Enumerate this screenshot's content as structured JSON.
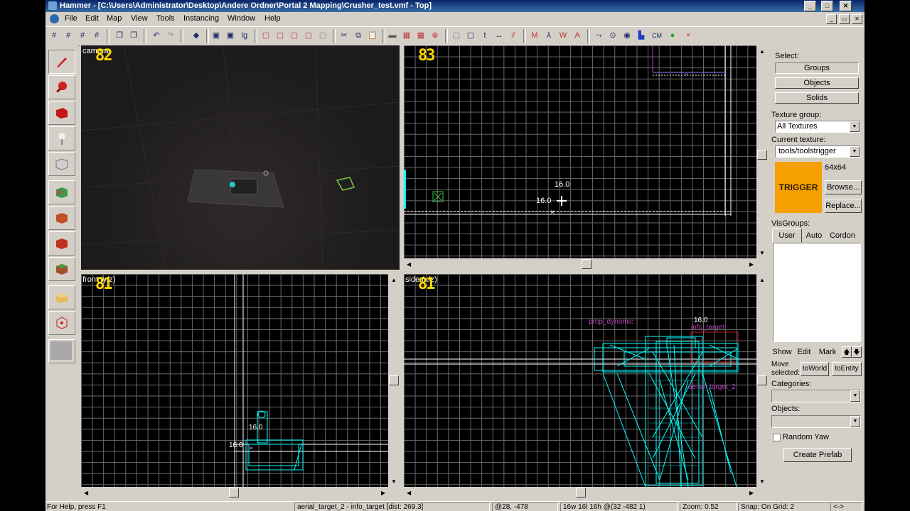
{
  "window": {
    "title": "Hammer - [C:\\Users\\Administrator\\Desktop\\Andere Ordner\\Portal 2 Mapping\\Crusher_test.vmf - Top]"
  },
  "title_controls": {
    "minimize": "_",
    "maximize": "□",
    "close": "✕"
  },
  "mdi_controls": {
    "minimize": "_",
    "restore": "▭",
    "close": "✕"
  },
  "menu": [
    "File",
    "Edit",
    "Map",
    "View",
    "Tools",
    "Instancing",
    "Window",
    "Help"
  ],
  "toolbar": {
    "cordon_label": "CM"
  },
  "viewports": {
    "camera": {
      "label": "camera",
      "number": "82"
    },
    "top": {
      "label": "",
      "number": "83",
      "dim_h": "16.0",
      "dim_v": "16.0"
    },
    "front": {
      "label": "front (y/z)",
      "number": "81",
      "dim_h": "16.0",
      "dim_v": "16.0"
    },
    "side": {
      "label": "side (x/z)",
      "number": "81",
      "dim_h": "16.0",
      "entity1": "prop_dynamic",
      "entity2": "info_target",
      "entity3": "aerial_target_2"
    }
  },
  "right_panel": {
    "select_label": "Select:",
    "groups_button": "Groups",
    "objects_button": "Objects",
    "solids_button": "Solids",
    "texture_group_label": "Texture group:",
    "texture_group_value": "All Textures",
    "current_texture_label": "Current texture:",
    "current_texture_value": "tools/toolstrigger",
    "texture_preview_text": "TRIGGER",
    "texture_size": "64x64",
    "browse_button": "Browse...",
    "replace_button": "Replace...",
    "visgroups_label": "VisGroups:",
    "tabs": [
      "User",
      "Auto",
      "Cordon"
    ],
    "show_button": "Show",
    "edit_button": "Edit",
    "mark_button": "Mark",
    "up_button": "🡅",
    "down_button": "🡇",
    "move_selected_label": "Move selected:",
    "to_world_button": "toWorld",
    "to_entity_button": "toEntity",
    "categories_label": "Categories:",
    "objects_label": "Objects:",
    "random_yaw_label": "Random Yaw",
    "create_prefab_button": "Create Prefab"
  },
  "status": {
    "help": "For Help, press F1",
    "selection": "aerial_target_2 - info_target  [dist: 269.3]",
    "coords": "@28, -478",
    "size": "16w 16l 16h @(32 -482 1)",
    "zoom": "Zoom: 0.52",
    "snap": "Snap: On Grid: 2",
    "nav": "<->"
  },
  "colors": {
    "title_bar": "#0a246a",
    "grid": "#6a6a6a",
    "selection": "#00ffff",
    "label_yellow": "#ffd700",
    "trigger_orange": "#f5a000",
    "entity_magenta": "#b040b0"
  }
}
